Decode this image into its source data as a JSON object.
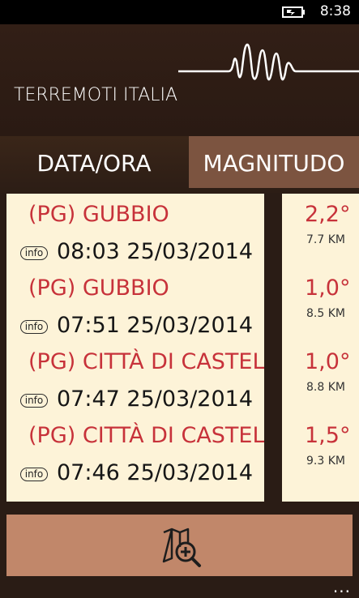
{
  "status_bar": {
    "time": "8:38"
  },
  "header": {
    "title": "TERREMOTI ITALIA"
  },
  "tabs": [
    {
      "label": "DATA/ORA",
      "active": false
    },
    {
      "label": "MAGNITUDO",
      "active": true
    }
  ],
  "earthquakes": [
    {
      "place": "(PG) GUBBIO",
      "info_label": "info",
      "time": "08:03 25/03/2014",
      "magnitude": "2,2°",
      "depth": "7.7 KM"
    },
    {
      "place": "(PG) GUBBIO",
      "info_label": "info",
      "time": "07:51 25/03/2014",
      "magnitude": "1,0°",
      "depth": "8.5 KM"
    },
    {
      "place": "(PG) CITTÀ DI CASTELLO",
      "info_label": "info",
      "time": "07:47 25/03/2014",
      "magnitude": "1,0°",
      "depth": "8.8 KM"
    },
    {
      "place": "(PG) CITTÀ DI CASTELLO",
      "info_label": "info",
      "time": "07:46 25/03/2014",
      "magnitude": "1,5°",
      "depth": "9.3 KM"
    }
  ],
  "app_bar": {
    "more": "..."
  },
  "colors": {
    "accent_red": "#c7323a",
    "list_bg": "#fdf3d8",
    "app_bar": "#c1876a",
    "tab_active": "#7c5440",
    "background": "#2a1c15"
  },
  "icons": {
    "battery": "battery-charging-icon",
    "map_zoom": "map-zoom-icon"
  }
}
